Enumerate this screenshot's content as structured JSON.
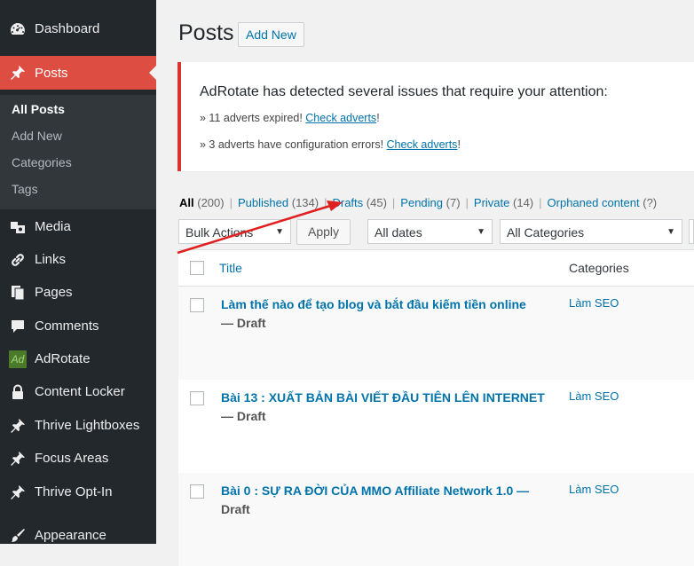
{
  "sidebar": {
    "items": [
      {
        "label": "Dashboard",
        "icon": "dashboard-icon"
      },
      {
        "label": "Posts",
        "icon": "pushpin-icon"
      },
      {
        "label": "Media",
        "icon": "media-icon"
      },
      {
        "label": "Links",
        "icon": "link-icon"
      },
      {
        "label": "Pages",
        "icon": "pages-icon"
      },
      {
        "label": "Comments",
        "icon": "comment-icon"
      },
      {
        "label": "AdRotate",
        "icon": "adrotate-icon",
        "badge": "Ad"
      },
      {
        "label": "Content Locker",
        "icon": "lock-icon"
      },
      {
        "label": "Thrive Lightboxes",
        "icon": "pushpin-icon"
      },
      {
        "label": "Focus Areas",
        "icon": "pushpin-icon"
      },
      {
        "label": "Thrive Opt-In",
        "icon": "pushpin-icon"
      },
      {
        "label": "Appearance",
        "icon": "paintbrush-icon"
      }
    ],
    "submenu": [
      "All Posts",
      "Add New",
      "Categories",
      "Tags"
    ]
  },
  "header": {
    "title": "Posts",
    "add_new": "Add New"
  },
  "notice": {
    "title": "AdRotate has detected several issues that require your attention:",
    "line1_text": "» 11 adverts expired! ",
    "line1_link": "Check adverts",
    "line1_end": "!",
    "line2_text": "» 3 adverts have configuration errors! ",
    "line2_link": "Check adverts",
    "line2_end": "!"
  },
  "filters": [
    {
      "label": "All",
      "count": "(200)"
    },
    {
      "label": "Published",
      "count": "(134)"
    },
    {
      "label": "Drafts",
      "count": "(45)"
    },
    {
      "label": "Pending",
      "count": "(7)"
    },
    {
      "label": "Private",
      "count": "(14)"
    },
    {
      "label": "Orphaned content",
      "count": "(?)"
    }
  ],
  "toolbar": {
    "bulk_actions": "Bulk Actions",
    "apply": "Apply",
    "dates": "All dates",
    "categories": "All Categories"
  },
  "table": {
    "headers": {
      "title": "Title",
      "categories": "Categories"
    },
    "rows": [
      {
        "title": "Làm thế nào để tạo blog và bắt đầu kiếm tiền online",
        "state": "— Draft",
        "category": "Làm SEO"
      },
      {
        "title": "Bài 13 : XUẤT BẢN BÀI VIẾT ĐẦU TIÊN LÊN INTERNET",
        "state": "— Draft",
        "category": "Làm SEO"
      },
      {
        "title": "Bài 0 : SỰ RA ĐỜI CỦA MMO Affiliate Network 1.0 —",
        "state": "Draft",
        "category": "Làm SEO"
      }
    ]
  },
  "colors": {
    "sidebar_bg": "#23282d",
    "active_menu": "#dd4d42",
    "link": "#0073aa",
    "notice_border": "#dc3232",
    "annotation_arrow": "#e02020"
  }
}
